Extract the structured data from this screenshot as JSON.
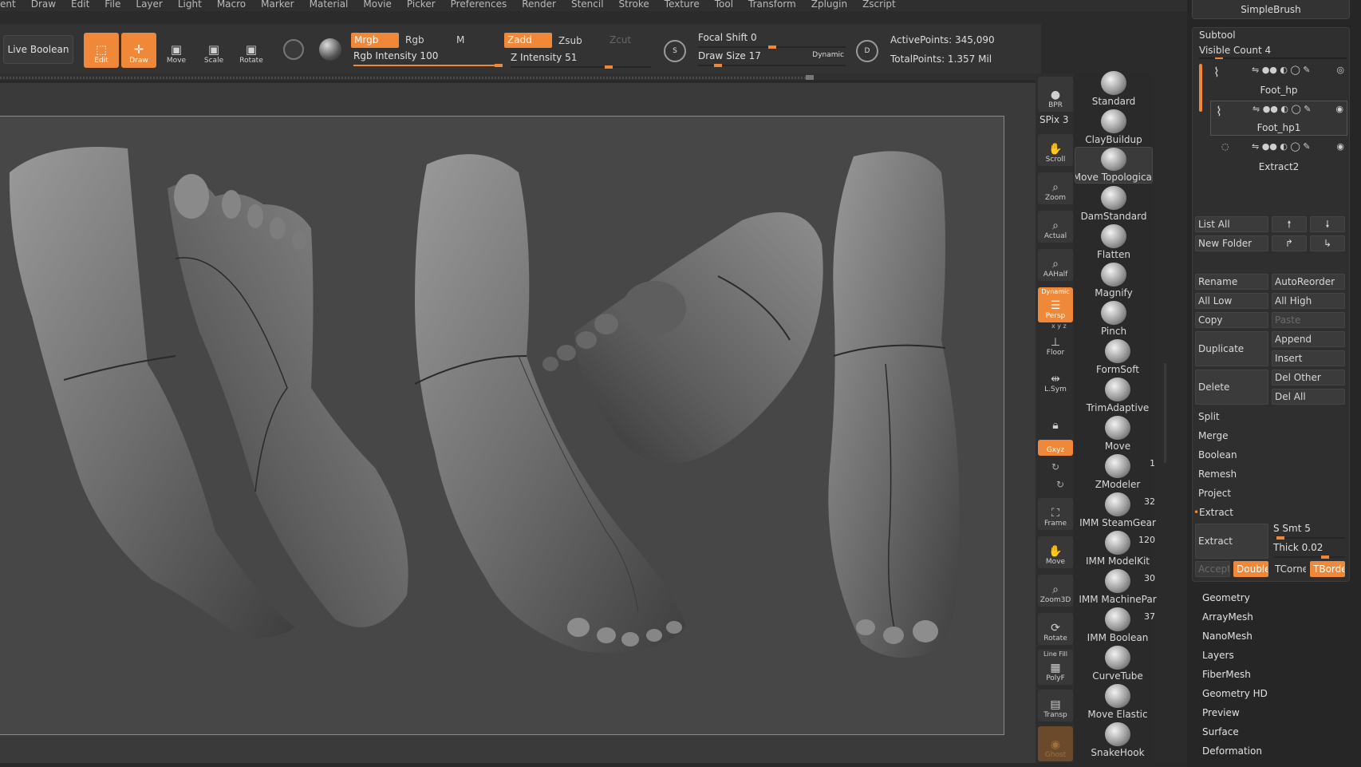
{
  "menu": [
    "ent",
    "Draw",
    "Edit",
    "File",
    "Layer",
    "Light",
    "Macro",
    "Marker",
    "Material",
    "Movie",
    "Picker",
    "Preferences",
    "Render",
    "Stencil",
    "Stroke",
    "Texture",
    "Tool",
    "Transform",
    "Zplugin",
    "Zscript"
  ],
  "toolbar": {
    "live_boolean": "Live Boolean",
    "edit": "Edit",
    "draw": "Draw",
    "move": "Move",
    "scale": "Scale",
    "rotate": "Rotate",
    "mrgb": "Mrgb",
    "rgb": "Rgb",
    "m": "M",
    "zadd": "Zadd",
    "zsub": "Zsub",
    "zcut": "Zcut",
    "rgb_intensity": "Rgb Intensity 100",
    "z_intensity": "Z Intensity 51",
    "rgb_intensity_value": 100,
    "z_intensity_value": 51,
    "focal_shift": "Focal Shift 0",
    "draw_size": "Draw Size 17",
    "dynamic": "Dynamic",
    "focal_shift_value": 0,
    "draw_size_value": 17,
    "s_btn": "S",
    "d_btn": "D",
    "active_points": "ActivePoints: 345,090",
    "total_points": "TotalPoints: 1.357 Mil"
  },
  "shelf": {
    "bpr": "BPR",
    "spix": "SPix 3",
    "scroll": "Scroll",
    "zoom": "Zoom",
    "actual": "Actual",
    "aahalf": "AAHalf",
    "dynamic": "Dynamic",
    "persp": "Persp",
    "xyz_axes": "x y z",
    "floor": "Floor",
    "lsym": "L.Sym",
    "gxyz": "Gxyz",
    "frame": "Frame",
    "move": "Move",
    "zoom3d": "Zoom3D",
    "rotate": "Rotate",
    "line_fill": "Line Fill",
    "polyf": "PolyF",
    "transp": "Transp",
    "ghost": "Ghost"
  },
  "brushes": [
    {
      "name": "Standard",
      "count": ""
    },
    {
      "name": "ClayBuildup",
      "count": ""
    },
    {
      "name": "Move Topological",
      "count": ""
    },
    {
      "name": "DamStandard",
      "count": ""
    },
    {
      "name": "Flatten",
      "count": ""
    },
    {
      "name": "Magnify",
      "count": ""
    },
    {
      "name": "Pinch",
      "count": ""
    },
    {
      "name": "FormSoft",
      "count": ""
    },
    {
      "name": "TrimAdaptive",
      "count": ""
    },
    {
      "name": "Move",
      "count": ""
    },
    {
      "name": "ZModeler",
      "count": "1"
    },
    {
      "name": "IMM SteamGear",
      "count": "32"
    },
    {
      "name": "IMM ModelKit",
      "count": "120"
    },
    {
      "name": "IMM MachinePar",
      "count": "30"
    },
    {
      "name": "IMM Boolean",
      "count": "37"
    },
    {
      "name": "CurveTube",
      "count": ""
    },
    {
      "name": "Move Elastic",
      "count": ""
    },
    {
      "name": "SnakeHook",
      "count": ""
    }
  ],
  "panel": {
    "simplebrush": "SimpleBrush",
    "subtool_title": "Subtool",
    "visible_count": "Visible Count 4",
    "subtools": [
      {
        "name": "Foot_hp",
        "selected": false
      },
      {
        "name": "Foot_hp1",
        "selected": true
      },
      {
        "name": "Extract2",
        "selected": false
      }
    ],
    "list_all": "List All",
    "new_folder": "New Folder",
    "rename": "Rename",
    "autoreorder": "AutoReorder",
    "all_low": "All Low",
    "all_high": "All High",
    "copy": "Copy",
    "paste": "Paste",
    "duplicate": "Duplicate",
    "append": "Append",
    "insert": "Insert",
    "delete": "Delete",
    "del_other": "Del Other",
    "del_all": "Del All",
    "split": "Split",
    "merge": "Merge",
    "boolean": "Boolean",
    "remesh": "Remesh",
    "project": "Project",
    "extract_section": "Extract",
    "extract_btn": "Extract",
    "s_smt": "S Smt 5",
    "thick": "Thick 0.02",
    "accept": "Accept",
    "double": "Double",
    "tcorne": "TCorne",
    "tborde": "TBorde",
    "sections": [
      "Geometry",
      "ArrayMesh",
      "NanoMesh",
      "Layers",
      "FiberMesh",
      "Geometry HD",
      "Preview",
      "Surface",
      "Deformation"
    ]
  },
  "colors": {
    "accent": "#f0883a",
    "bg": "#2b2b2b",
    "canvas": "#474747"
  }
}
